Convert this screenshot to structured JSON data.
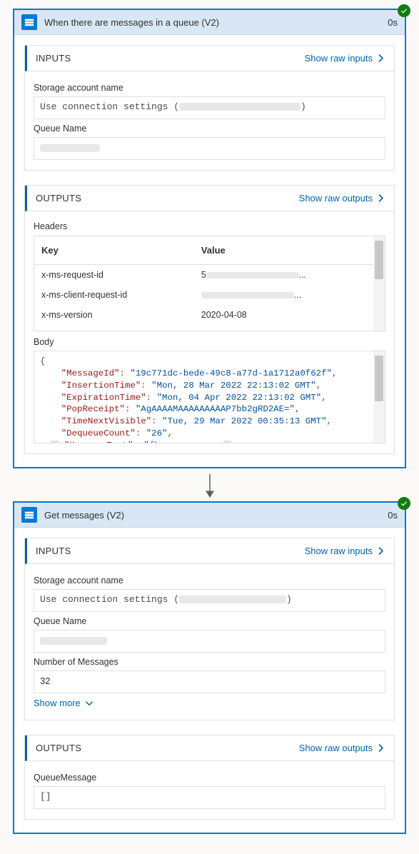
{
  "ui": {
    "show_raw_inputs": "Show raw inputs",
    "show_raw_outputs": "Show raw outputs",
    "inputs_title": "INPUTS",
    "outputs_title": "OUTPUTS",
    "headers_label": "Headers",
    "body_label": "Body",
    "key_col": "Key",
    "value_col": "Value",
    "show_more": "Show more"
  },
  "step1": {
    "title": "When there are messages in a queue (V2)",
    "duration": "0s",
    "inputs": {
      "storage_label": "Storage account name",
      "storage_value_prefix": "Use connection settings (",
      "storage_value_suffix": ")",
      "queue_label": "Queue Name"
    },
    "headers_table": [
      {
        "k": "x-ms-request-id",
        "v": "5"
      },
      {
        "k": "x-ms-client-request-id",
        "v": ""
      },
      {
        "k": "x-ms-version",
        "v": "2020-04-08"
      }
    ],
    "body_json": {
      "MessageId": "19c771dc-bede-49c8-a77d-1a1712a0f62f",
      "InsertionTime": "Mon, 28 Mar 2022 22:13:02 GMT",
      "ExpirationTime": "Mon, 04 Apr 2022 22:13:02 GMT",
      "PopReceipt": "AgAAAAMAAAAAAAAAP7bb2gRD2AE=",
      "TimeNextVisible": "Tue, 29 Mar 2022 00:35:13 GMT",
      "DequeueCount": "26",
      "MessageText_trunc": "\"{\\n"
    }
  },
  "step2": {
    "title": "Get messages (V2)",
    "duration": "0s",
    "inputs": {
      "storage_label": "Storage account name",
      "storage_value_prefix": "Use connection settings (",
      "storage_value_suffix": ")",
      "queue_label": "Queue Name",
      "num_label": "Number of Messages",
      "num_value": "32"
    },
    "outputs": {
      "queue_msg_label": "QueueMessage",
      "queue_msg_value": "[]"
    }
  }
}
